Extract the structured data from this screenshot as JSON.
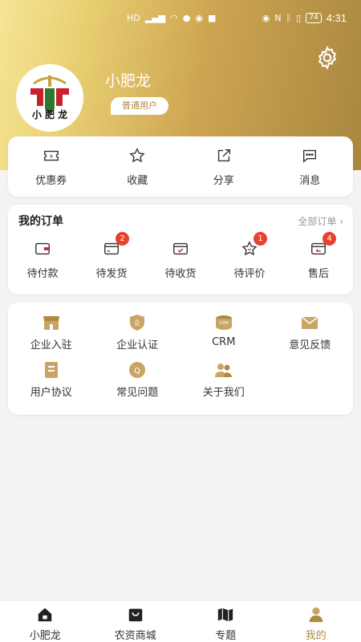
{
  "status_bar": {
    "time": "4:31",
    "battery": "74",
    "carrier": "HD"
  },
  "profile": {
    "name": "小肥龙",
    "badge": "普通用户",
    "logo_text": "小 肥 龙"
  },
  "quick_actions": [
    {
      "label": "优惠券",
      "icon": "coupon-icon"
    },
    {
      "label": "收藏",
      "icon": "star-icon"
    },
    {
      "label": "分享",
      "icon": "share-icon"
    },
    {
      "label": "消息",
      "icon": "message-icon"
    }
  ],
  "orders": {
    "title": "我的订单",
    "all_label": "全部订单",
    "items": [
      {
        "label": "待付款",
        "icon": "wallet-icon",
        "count": ""
      },
      {
        "label": "待发货",
        "icon": "card-icon",
        "count": "2"
      },
      {
        "label": "待收货",
        "icon": "receive-icon",
        "count": ""
      },
      {
        "label": "待评价",
        "icon": "review-star-icon",
        "count": "1"
      },
      {
        "label": "售后",
        "icon": "return-icon",
        "count": "4"
      }
    ]
  },
  "services": [
    {
      "label": "企业入驻",
      "icon": "store-icon"
    },
    {
      "label": "企业认证",
      "icon": "certify-icon"
    },
    {
      "label": "CRM",
      "icon": "crm-icon",
      "icon_text": "CRM"
    },
    {
      "label": "意见反馈",
      "icon": "feedback-icon"
    },
    {
      "label": "用户协议",
      "icon": "agreement-icon"
    },
    {
      "label": "常见问题",
      "icon": "faq-icon"
    },
    {
      "label": "关于我们",
      "icon": "about-icon"
    }
  ],
  "tabbar": [
    {
      "label": "小肥龙",
      "icon": "home-icon"
    },
    {
      "label": "农资商城",
      "icon": "shop-bag-icon"
    },
    {
      "label": "专题",
      "icon": "map-icon"
    },
    {
      "label": "我的",
      "icon": "profile-icon"
    }
  ],
  "colors": {
    "accent": "#b08a3e",
    "badge_red": "#e8412f",
    "header_gradient_start": "#f6e596",
    "header_gradient_end": "#a8873f"
  }
}
